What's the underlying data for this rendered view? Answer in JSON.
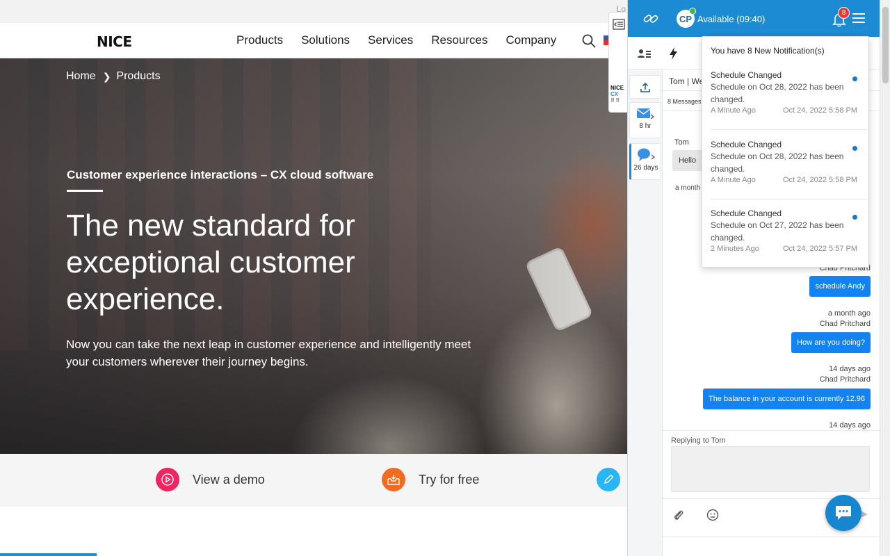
{
  "site": {
    "topstrip_text": "Lo",
    "logo": "NICE",
    "nav": [
      "Products",
      "Solutions",
      "Services",
      "Resources",
      "Company"
    ],
    "breadcrumb": [
      "Home",
      "Products"
    ],
    "eyebrow": "Customer experience interactions – CX cloud software",
    "headline": "The new standard for exceptional customer experience.",
    "lede": "Now you can take the next leap in customer experience and intelligently meet your customers wherever their journey begins.",
    "ctas": [
      {
        "label": "View a demo",
        "icon": "play-icon",
        "color": "#f0245f"
      },
      {
        "label": "Try for free",
        "icon": "inbox-icon",
        "color": "#f26b21"
      },
      {
        "label": "",
        "icon": "pencil-icon",
        "color": "#29b6f6"
      }
    ],
    "widget_tab_logo": [
      "NICE",
      "CX"
    ]
  },
  "panel": {
    "avatar_initials": "CP",
    "status": "Available (09:40)",
    "notification_count": "8",
    "rail": [
      {
        "icon": "upload-icon",
        "caption": ""
      },
      {
        "icon": "email-icon",
        "caption": "8 hr"
      },
      {
        "icon": "chat-icon",
        "caption": "26 days"
      }
    ],
    "chat": {
      "tab_name": "Tom | We",
      "message_count": "8 Messages",
      "incoming": {
        "sender": "Tom",
        "text": "Hello",
        "time": "a month"
      },
      "outgoing": [
        {
          "time": "",
          "sender": "Chad Pritchard",
          "text": "schedule Andy"
        },
        {
          "time": "a month ago",
          "sender": "Chad Pritchard",
          "text": "How are you doing?"
        },
        {
          "time": "14 days ago",
          "sender": "Chad Pritchard",
          "text": "The balance in your account is currently 12.96"
        },
        {
          "time": "14 days ago",
          "sender": "",
          "text": ""
        }
      ],
      "reply_label": "Replying to Tom"
    },
    "notifications": {
      "header": "You have 8 New Notification(s)",
      "items": [
        {
          "title": "Schedule Changed",
          "body": "Schedule on Oct 28, 2022 has been changed.",
          "relative": "A Minute Ago",
          "timestamp": "Oct 24, 2022 5:58 PM"
        },
        {
          "title": "Schedule Changed",
          "body": "Schedule on Oct 28, 2022 has been changed.",
          "relative": "A Minute Ago",
          "timestamp": "Oct 24, 2022 5:58 PM"
        },
        {
          "title": "Schedule Changed",
          "body": "Schedule on Oct 27, 2022 has been changed.",
          "relative": "2 Minutes Ago",
          "timestamp": "Oct 24, 2022 5:57 PM"
        }
      ]
    }
  },
  "colors": {
    "brand_blue": "#1c8bd4",
    "bubble_blue": "#1283f0",
    "badge_red": "#e53935",
    "online_green": "#4caf50"
  }
}
